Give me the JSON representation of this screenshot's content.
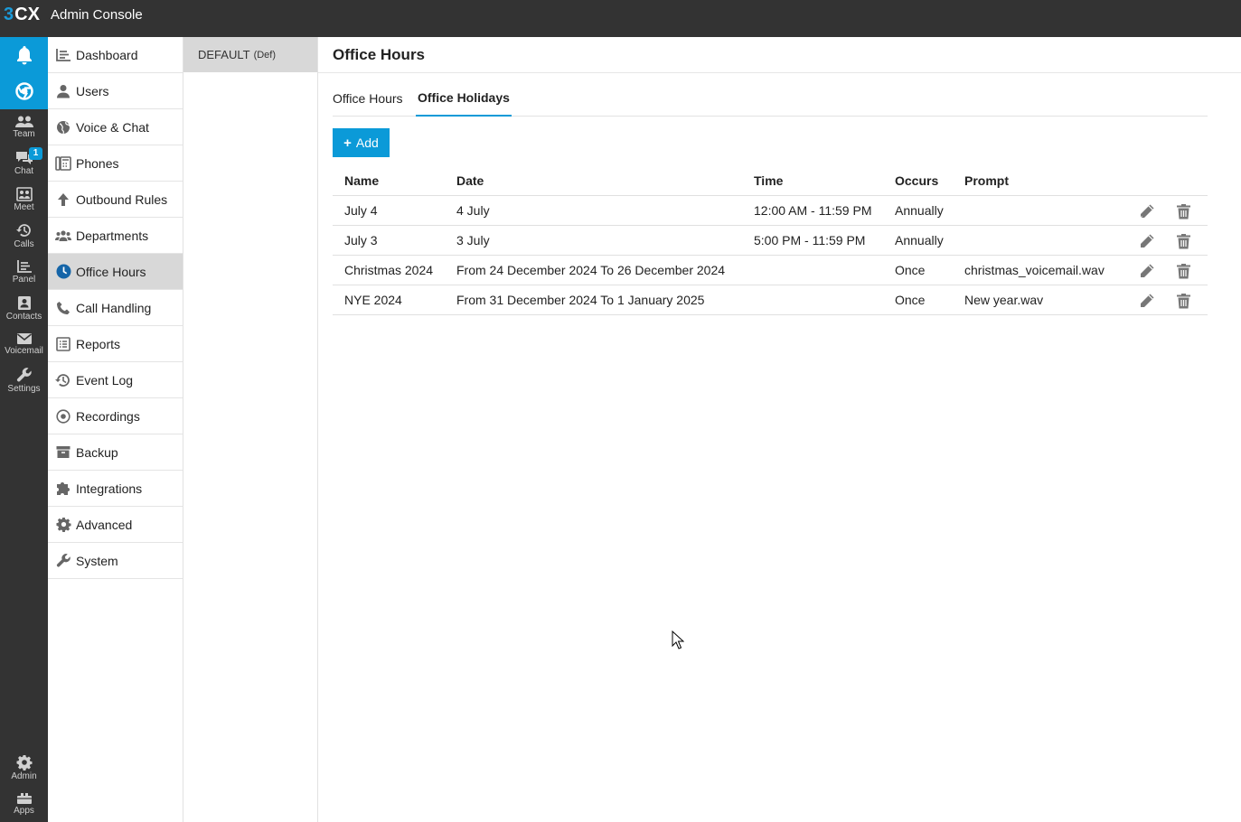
{
  "header": {
    "logo_prefix": "3",
    "logo_suffix": "CX",
    "title": "Admin Console"
  },
  "rail": {
    "items": [
      {
        "label": "Team",
        "icon": "team-icon"
      },
      {
        "label": "Chat",
        "icon": "chat-icon",
        "badge": "1"
      },
      {
        "label": "Meet",
        "icon": "meet-icon"
      },
      {
        "label": "Calls",
        "icon": "calls-history-icon"
      },
      {
        "label": "Panel",
        "icon": "panel-icon"
      },
      {
        "label": "Contacts",
        "icon": "contacts-icon"
      },
      {
        "label": "Voicemail",
        "icon": "voicemail-icon"
      },
      {
        "label": "Settings",
        "icon": "wrench-icon"
      }
    ],
    "bottom": [
      {
        "label": "Admin",
        "icon": "gear-icon"
      },
      {
        "label": "Apps",
        "icon": "apps-icon"
      }
    ]
  },
  "nav": {
    "items": [
      {
        "label": "Dashboard",
        "icon": "dashboard-icon"
      },
      {
        "label": "Users",
        "icon": "user-icon"
      },
      {
        "label": "Voice & Chat",
        "icon": "globe-icon"
      },
      {
        "label": "Phones",
        "icon": "phone-device-icon"
      },
      {
        "label": "Outbound Rules",
        "icon": "arrow-up-icon"
      },
      {
        "label": "Departments",
        "icon": "departments-icon"
      },
      {
        "label": "Office Hours",
        "icon": "clock-icon",
        "active": true
      },
      {
        "label": "Call Handling",
        "icon": "phone-handset-icon"
      },
      {
        "label": "Reports",
        "icon": "reports-icon"
      },
      {
        "label": "Event Log",
        "icon": "history-icon"
      },
      {
        "label": "Recordings",
        "icon": "record-icon"
      },
      {
        "label": "Backup",
        "icon": "archive-icon"
      },
      {
        "label": "Integrations",
        "icon": "puzzle-icon"
      },
      {
        "label": "Advanced",
        "icon": "gear-icon"
      },
      {
        "label": "System",
        "icon": "wrench-icon"
      }
    ]
  },
  "sub": {
    "item_label": "DEFAULT",
    "item_suffix": "(Def)"
  },
  "main": {
    "title": "Office Hours",
    "tabs": [
      {
        "label": "Office Hours",
        "active": false
      },
      {
        "label": "Office Holidays",
        "active": true
      }
    ],
    "add_label": "Add",
    "table": {
      "headers": [
        "Name",
        "Date",
        "Time",
        "Occurs",
        "Prompt"
      ],
      "rows": [
        {
          "name": "July 4",
          "date": "4 July",
          "time": "12:00 AM - 11:59 PM",
          "occurs": "Annually",
          "prompt": ""
        },
        {
          "name": "July 3",
          "date": "3 July",
          "time": "5:00 PM - 11:59 PM",
          "occurs": "Annually",
          "prompt": ""
        },
        {
          "name": "Christmas 2024",
          "date": "From 24 December 2024 To 26 December 2024",
          "time": "",
          "occurs": "Once",
          "prompt": "christmas_voicemail.wav"
        },
        {
          "name": "NYE 2024",
          "date": "From 31 December 2024 To 1 January 2025",
          "time": "",
          "occurs": "Once",
          "prompt": "New year.wav"
        }
      ]
    }
  },
  "colors": {
    "accent": "#0b9ad8",
    "topbar": "#333333",
    "active_nav": "#d8d8d8"
  }
}
